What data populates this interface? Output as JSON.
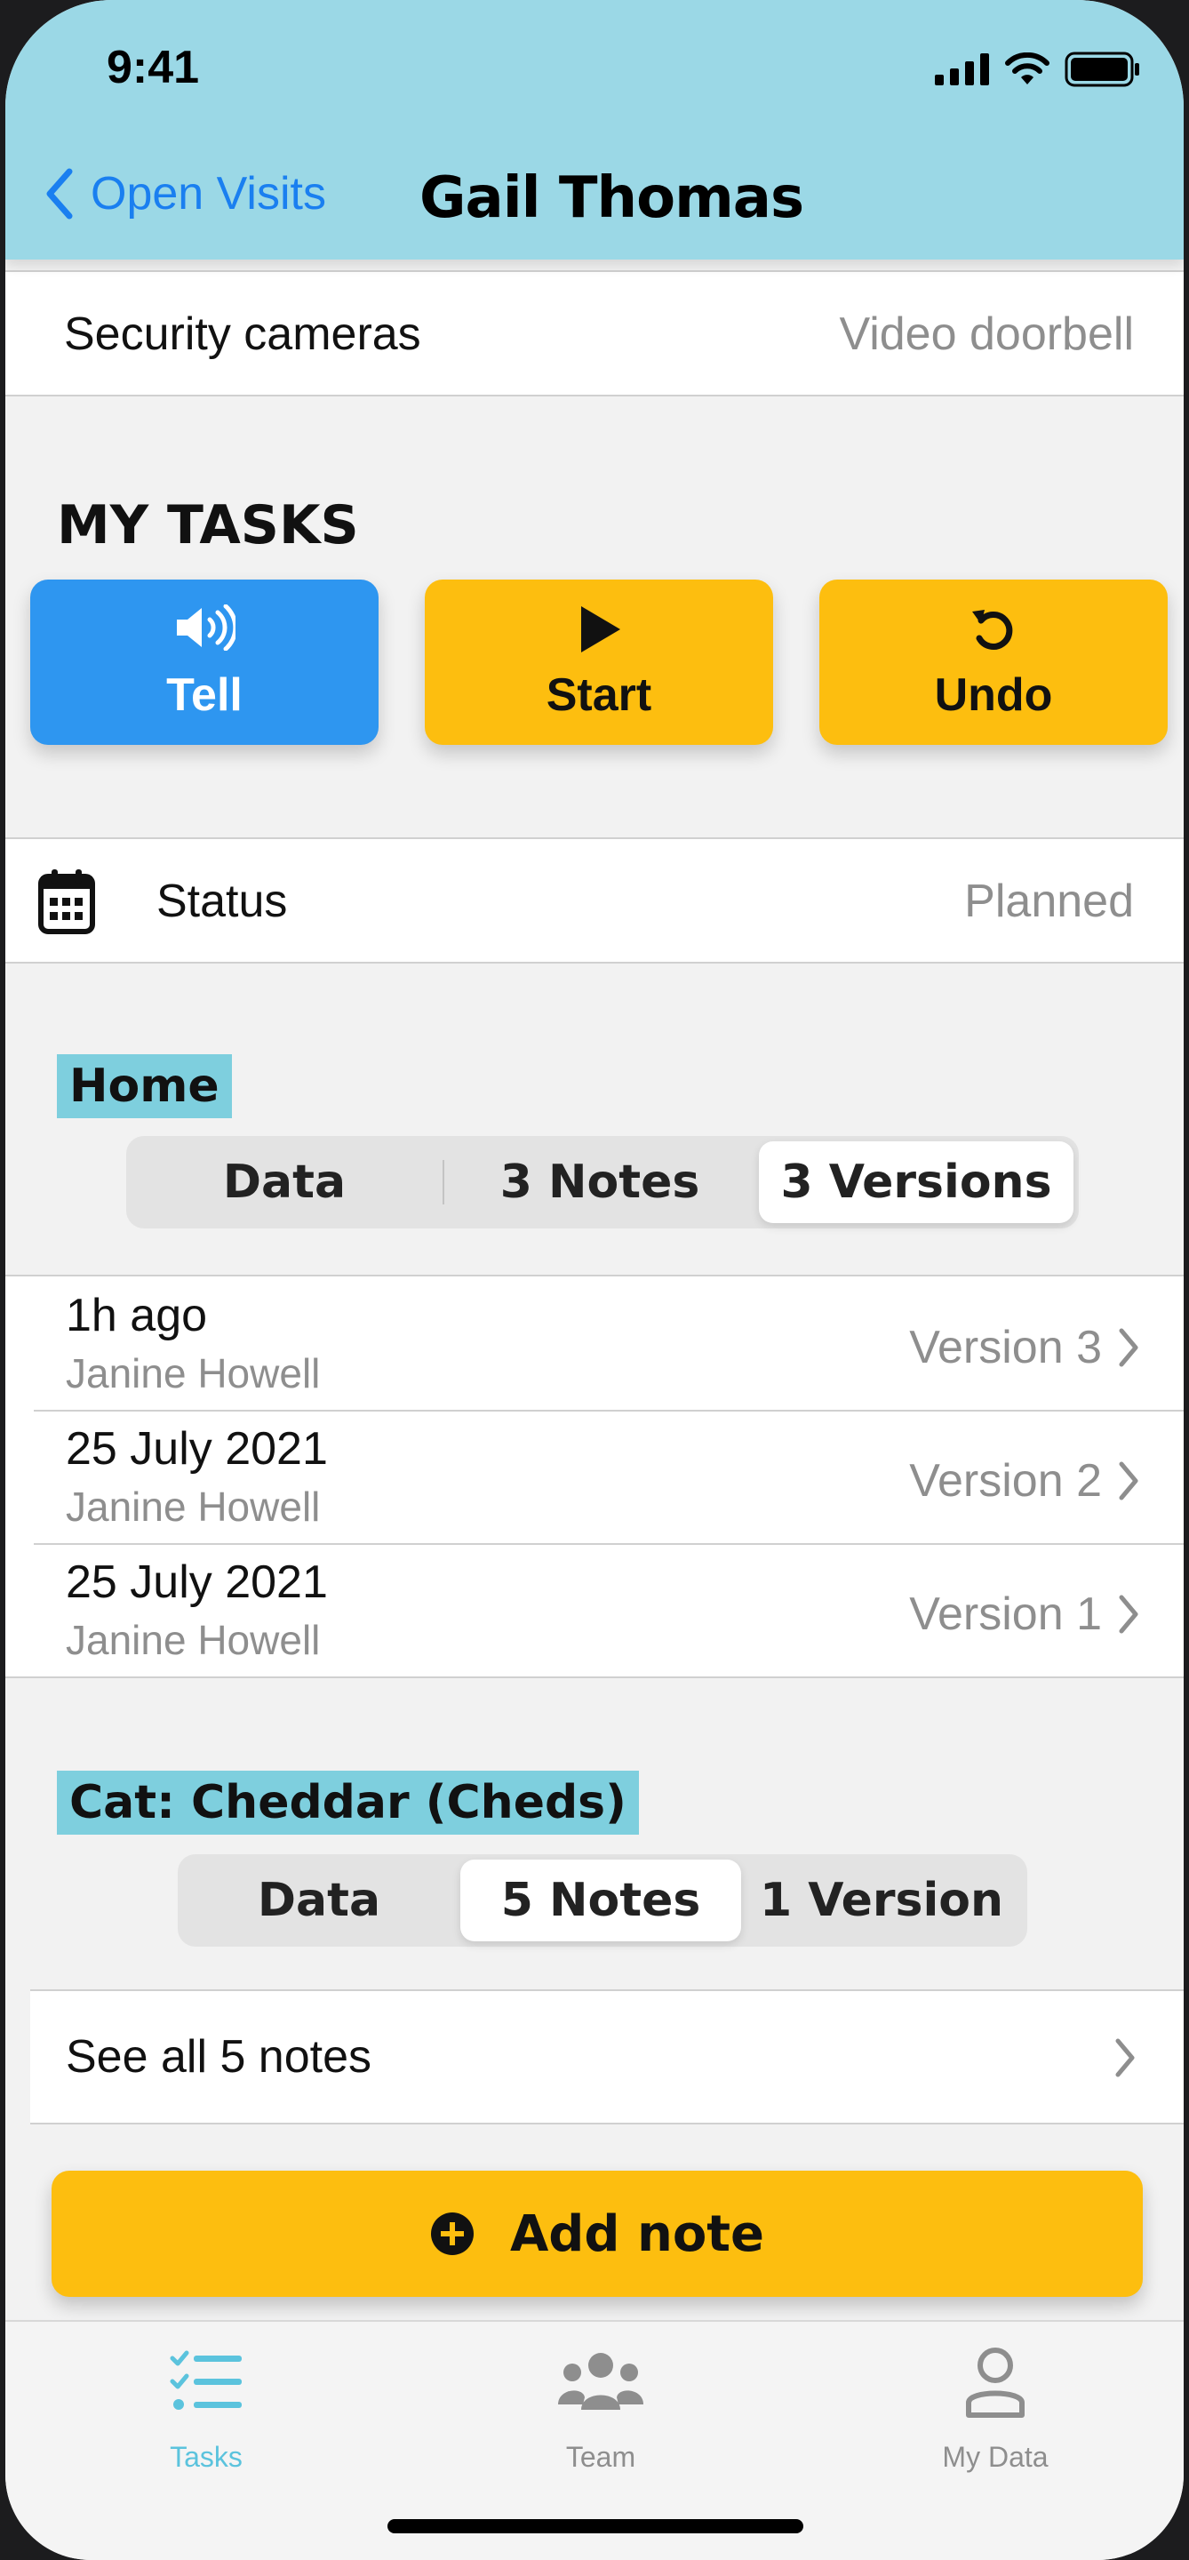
{
  "status_bar": {
    "time": "9:41"
  },
  "nav": {
    "back_label": "Open Visits",
    "title": "Gail Thomas"
  },
  "security_row": {
    "label": "Security cameras",
    "value": "Video doorbell"
  },
  "tasks": {
    "heading": "MY TASKS",
    "buttons": [
      {
        "label": "Tell",
        "icon": "speaker-icon",
        "color": "#2e96f0"
      },
      {
        "label": "Start",
        "icon": "play-icon",
        "color": "#fdbe0f"
      },
      {
        "label": "Undo",
        "icon": "undo-icon",
        "color": "#fdbe0f"
      }
    ]
  },
  "status_row": {
    "label": "Status",
    "value": "Planned",
    "icon": "calendar-icon"
  },
  "home_group": {
    "label": "Home",
    "segments": [
      "Data",
      "3 Notes",
      "3 Versions"
    ],
    "selected_segment": "3 Versions",
    "versions": [
      {
        "time": "1h ago",
        "author": "Janine Howell",
        "version": "Version 3"
      },
      {
        "time": "25 July 2021",
        "author": "Janine Howell",
        "version": "Version 2"
      },
      {
        "time": "25 July 2021",
        "author": "Janine Howell",
        "version": "Version 1"
      }
    ]
  },
  "cat_group": {
    "label": "Cat: Cheddar (Cheds)",
    "segments": [
      "Data",
      "5 Notes",
      "1 Version"
    ],
    "selected_segment": "5 Notes",
    "see_all": "See all 5 notes"
  },
  "add_note": {
    "label": "Add note",
    "icon": "plus-circle-icon"
  },
  "tabbar": {
    "tabs": [
      {
        "label": "Tasks",
        "icon": "tasks-list-icon",
        "active": true
      },
      {
        "label": "Team",
        "icon": "team-icon",
        "active": false
      },
      {
        "label": "My Data",
        "icon": "person-icon",
        "active": false
      }
    ]
  },
  "colors": {
    "header": "#9bd8e6",
    "accent_blue": "#2e96f0",
    "accent_yellow": "#fdbe0f",
    "highlight": "#7ecfde",
    "link": "#1a7ff0"
  }
}
